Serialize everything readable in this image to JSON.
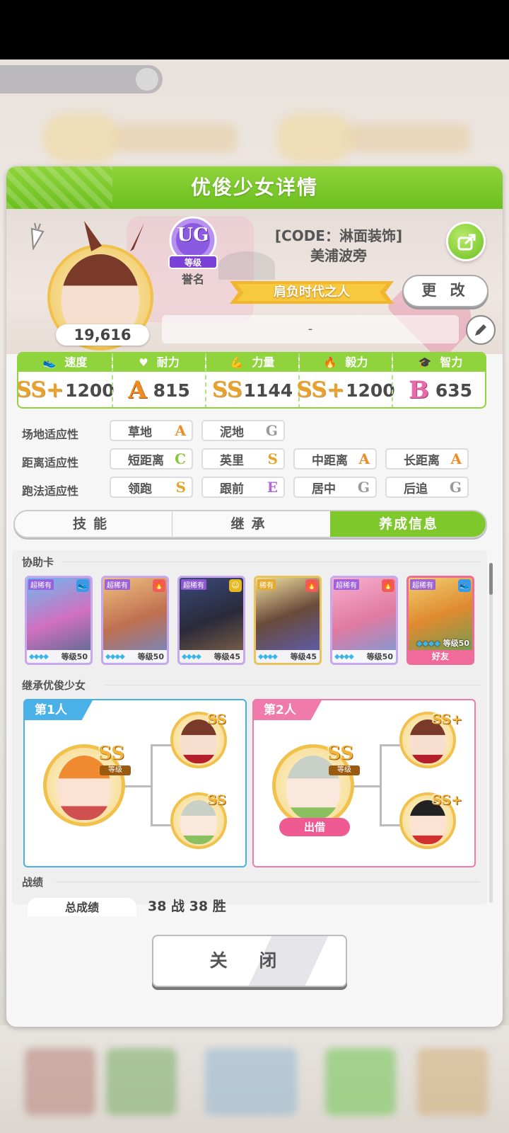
{
  "dialog": {
    "title": "优俊少女详情",
    "close_label": "关 闭"
  },
  "profile": {
    "score": "19,616",
    "rank_letters": "UG",
    "rank_caption": "等级",
    "rank_label": "誉名",
    "title_line": "[CODE：淋面装饰]",
    "name": "美浦波旁",
    "epithet": "肩负时代之人",
    "change_label": "更 改",
    "comment": "-"
  },
  "stats": [
    {
      "name": "速度",
      "grade": "SS+",
      "value": "1200",
      "icon": "shoe-icon"
    },
    {
      "name": "耐力",
      "grade": "A",
      "value": "815",
      "icon": "heart-icon"
    },
    {
      "name": "力量",
      "grade": "SS",
      "value": "1144",
      "icon": "muscle-icon"
    },
    {
      "name": "毅力",
      "grade": "SS+",
      "value": "1200",
      "icon": "flame-icon"
    },
    {
      "name": "智力",
      "grade": "B",
      "value": "635",
      "icon": "graduation-cap-icon"
    }
  ],
  "aptitude": {
    "track_label": "场地适应性",
    "distance_label": "距离适应性",
    "style_label": "跑法适应性",
    "track": [
      {
        "name": "草地",
        "grade": "A"
      },
      {
        "name": "泥地",
        "grade": "G"
      }
    ],
    "distance": [
      {
        "name": "短距离",
        "grade": "C"
      },
      {
        "name": "英里",
        "grade": "S"
      },
      {
        "name": "中距离",
        "grade": "A"
      },
      {
        "name": "长距离",
        "grade": "A"
      }
    ],
    "style": [
      {
        "name": "领跑",
        "grade": "S"
      },
      {
        "name": "跟前",
        "grade": "E"
      },
      {
        "name": "居中",
        "grade": "G"
      },
      {
        "name": "后追",
        "grade": "G"
      }
    ]
  },
  "tabs": [
    {
      "label": "技能"
    },
    {
      "label": "继承"
    },
    {
      "label": "养成信息"
    }
  ],
  "support": {
    "label": "协助卡",
    "cards": [
      {
        "rarity": "超稀有",
        "level": "等级50"
      },
      {
        "rarity": "超稀有",
        "level": "等级50"
      },
      {
        "rarity": "超稀有",
        "level": "等级45"
      },
      {
        "rarity": "稀有",
        "level": "等级45"
      },
      {
        "rarity": "超稀有",
        "level": "等级50"
      },
      {
        "rarity": "超稀有",
        "level": "等级50",
        "friend": "好友"
      }
    ]
  },
  "inherit": {
    "label": "继承优俊少女",
    "parent1": "第1人",
    "parent2": "第2人",
    "rank": "SS",
    "rank_plus": "SS+",
    "rank_caption": "等级",
    "lend": "出借"
  },
  "record": {
    "label": "战绩",
    "total_label": "总成绩",
    "total_value": "38 战 38 胜"
  }
}
